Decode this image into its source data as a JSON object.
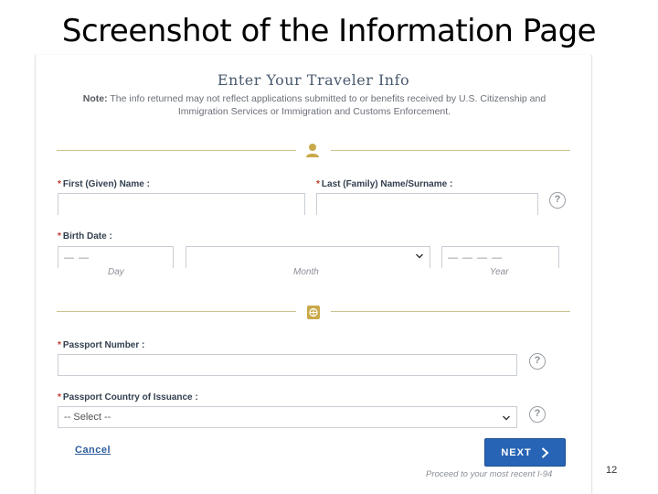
{
  "slide": {
    "title": "Screenshot of the Information Page",
    "page_number": "12"
  },
  "form": {
    "heading": "Enter Your Traveler Info",
    "note_label": "Note:",
    "note_text": "The info returned may not reflect applications submitted to or benefits received by U.S. Citizenship and Immigration Services or Immigration and Customs Enforcement.",
    "required_marker": "*",
    "sections": {
      "person_icon": "person-icon",
      "passport_icon": "passport-icon"
    },
    "first_name": {
      "label": "First (Given) Name :",
      "value": ""
    },
    "last_name": {
      "label": "Last (Family) Name/Surname :",
      "value": ""
    },
    "birth_date": {
      "label": "Birth Date :",
      "day_placeholder": "— —",
      "day_label": "Day",
      "month_value": "",
      "month_label": "Month",
      "year_placeholder": "— — — —",
      "year_label": "Year"
    },
    "passport_number": {
      "label": "Passport Number :",
      "value": ""
    },
    "passport_country": {
      "label": "Passport Country of Issuance :",
      "selected": "-- Select --"
    },
    "help_glyph": "?",
    "cancel_label": "Cancel",
    "next_label": "NEXT",
    "proceed_text": "Proceed to your most recent I-94"
  },
  "colors": {
    "accent_gold": "#c9c48c",
    "primary_blue": "#2764b5",
    "required_red": "#c0392b"
  }
}
